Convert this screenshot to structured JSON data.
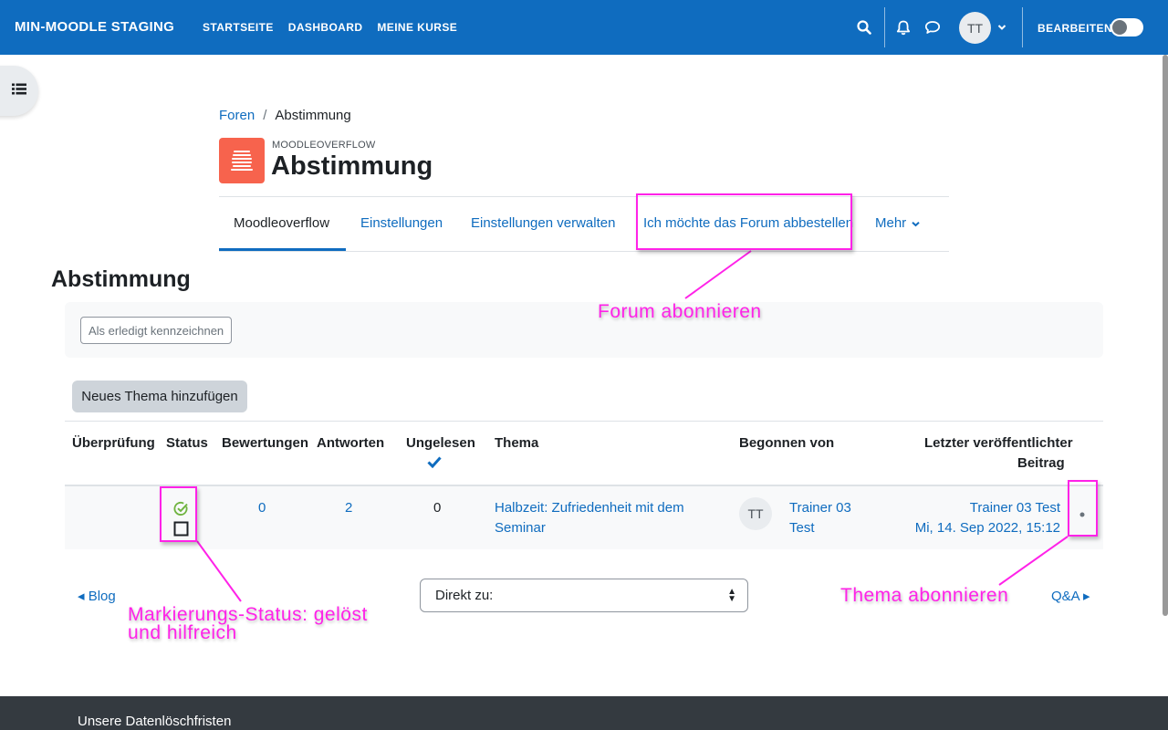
{
  "navbar": {
    "brand": "MIN-MOODLE STAGING",
    "links": [
      "STARTSEITE",
      "DASHBOARD",
      "MEINE KURSE"
    ],
    "avatar_initials": "TT",
    "edit_mode_label": "BEARBEITEN",
    "edit_mode_on": false,
    "icons": [
      "search-icon",
      "bell-icon",
      "chat-icon",
      "chevron-down-icon"
    ]
  },
  "breadcrumb": {
    "parent": "Foren",
    "separator": "/",
    "current": "Abstimmung"
  },
  "activity": {
    "type_label": "MOODLEOVERFLOW",
    "title": "Abstimmung",
    "icon": "moodleoverflow-icon",
    "icon_color": "#f7634d"
  },
  "secondary_nav": {
    "tabs": [
      "Moodleoverflow",
      "Einstellungen",
      "Einstellungen verwalten",
      "Ich möchte das Forum abbestellen"
    ],
    "more": "Mehr",
    "active_index": 0
  },
  "main": {
    "heading": "Abstimmung",
    "mark_done_button": "Als erledigt kennzeichnen",
    "add_topic_button": "Neues Thema hinzufügen"
  },
  "table": {
    "headers": [
      "Überprüfung",
      "Status",
      "Bewertungen",
      "Antworten",
      "Ungelesen",
      "Thema",
      "Begonnen von",
      "Letzter veröffentlichter",
      "Beitrag"
    ],
    "rows": [
      {
        "status_icons": [
          "solved-check-icon",
          "helpful-checkbox-icon"
        ],
        "ratings": "0",
        "replies": "2",
        "unread": "0",
        "topic_line1": "Halbzeit: Zufriedenheit mit dem",
        "topic_line2": "Seminar",
        "author_initials": "TT",
        "author_line1": "Trainer 03",
        "author_line2": "Test",
        "last_post_author": "Trainer 03 Test",
        "last_post_date": "Mi, 14. Sep 2022, 15:12"
      }
    ]
  },
  "activity_nav": {
    "prev": "◂ Blog",
    "jump_placeholder": "Direkt zu:",
    "next": "Q&A ▸"
  },
  "footer": {
    "text": "Unsere Datenlöschfristen"
  },
  "annotations": {
    "forum_subscribe": "Forum abonnieren",
    "status_line1": "Markierungs-Status: gelöst",
    "status_line2": "und hilfreich",
    "topic_subscribe": "Thema abonnieren",
    "color": "#ff22e8"
  }
}
